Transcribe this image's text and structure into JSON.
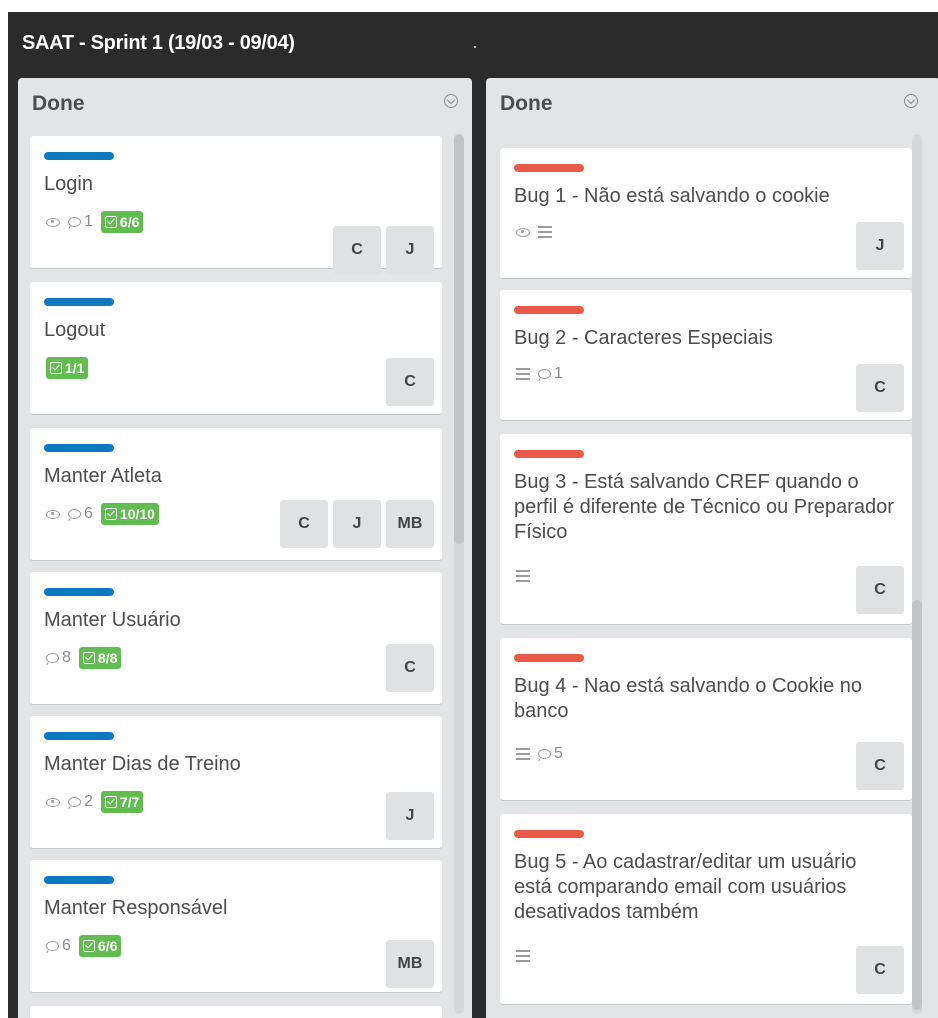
{
  "board": {
    "title": "SAAT - Sprint 1 (19/03 - 09/04)"
  },
  "lists": [
    {
      "title": "Done",
      "cards": [
        {
          "label_color": "blue",
          "title": "Login",
          "watching": true,
          "comments": "1",
          "checklist": "6/6",
          "description": false,
          "members": [
            "C",
            "J"
          ]
        },
        {
          "label_color": "blue",
          "title": "Logout",
          "watching": false,
          "comments": "",
          "checklist": "1/1",
          "description": false,
          "members": [
            "C"
          ]
        },
        {
          "label_color": "blue",
          "title": "Manter Atleta",
          "watching": true,
          "comments": "6",
          "checklist": "10/10",
          "description": false,
          "members": [
            "C",
            "J",
            "MB"
          ]
        },
        {
          "label_color": "blue",
          "title": "Manter Usuário",
          "watching": false,
          "comments": "8",
          "checklist": "8/8",
          "description": false,
          "members": [
            "C"
          ]
        },
        {
          "label_color": "blue",
          "title": "Manter Dias de Treino",
          "watching": true,
          "comments": "2",
          "checklist": "7/7",
          "description": false,
          "members": [
            "J"
          ]
        },
        {
          "label_color": "blue",
          "title": "Manter Responsável",
          "watching": false,
          "comments": "6",
          "checklist": "6/6",
          "description": false,
          "members": [
            "MB"
          ]
        }
      ]
    },
    {
      "title": "Done",
      "cards": [
        {
          "label_color": "red",
          "title": "Bug 1 - Não está salvando o cookie",
          "watching": true,
          "comments": "",
          "checklist": "",
          "description": true,
          "members": [
            "J"
          ]
        },
        {
          "label_color": "red",
          "title": "Bug 2 - Caracteres Especiais",
          "watching": false,
          "comments": "1",
          "checklist": "",
          "description": true,
          "members": [
            "C"
          ]
        },
        {
          "label_color": "red",
          "title": "Bug 3 - Está salvando CREF quando o perfil é diferente de Técnico ou Preparador Físico",
          "watching": false,
          "comments": "",
          "checklist": "",
          "description": true,
          "members": [
            "C"
          ]
        },
        {
          "label_color": "red",
          "title": "Bug 4 - Nao está salvando o Cookie no banco",
          "watching": false,
          "comments": "5",
          "checklist": "",
          "description": true,
          "members": [
            "C"
          ]
        },
        {
          "label_color": "red",
          "title": "Bug 5 - Ao cadastrar/editar um usuário está comparando email com usuários desativados também",
          "watching": false,
          "comments": "",
          "checklist": "",
          "description": true,
          "members": [
            "C"
          ]
        }
      ]
    }
  ],
  "colors": {
    "label_blue": "#0f79bf",
    "label_red": "#eb5a46",
    "checklist_green": "#61bd4f",
    "board_bg": "#2b2b2b",
    "list_bg": "#e2e4e6"
  }
}
